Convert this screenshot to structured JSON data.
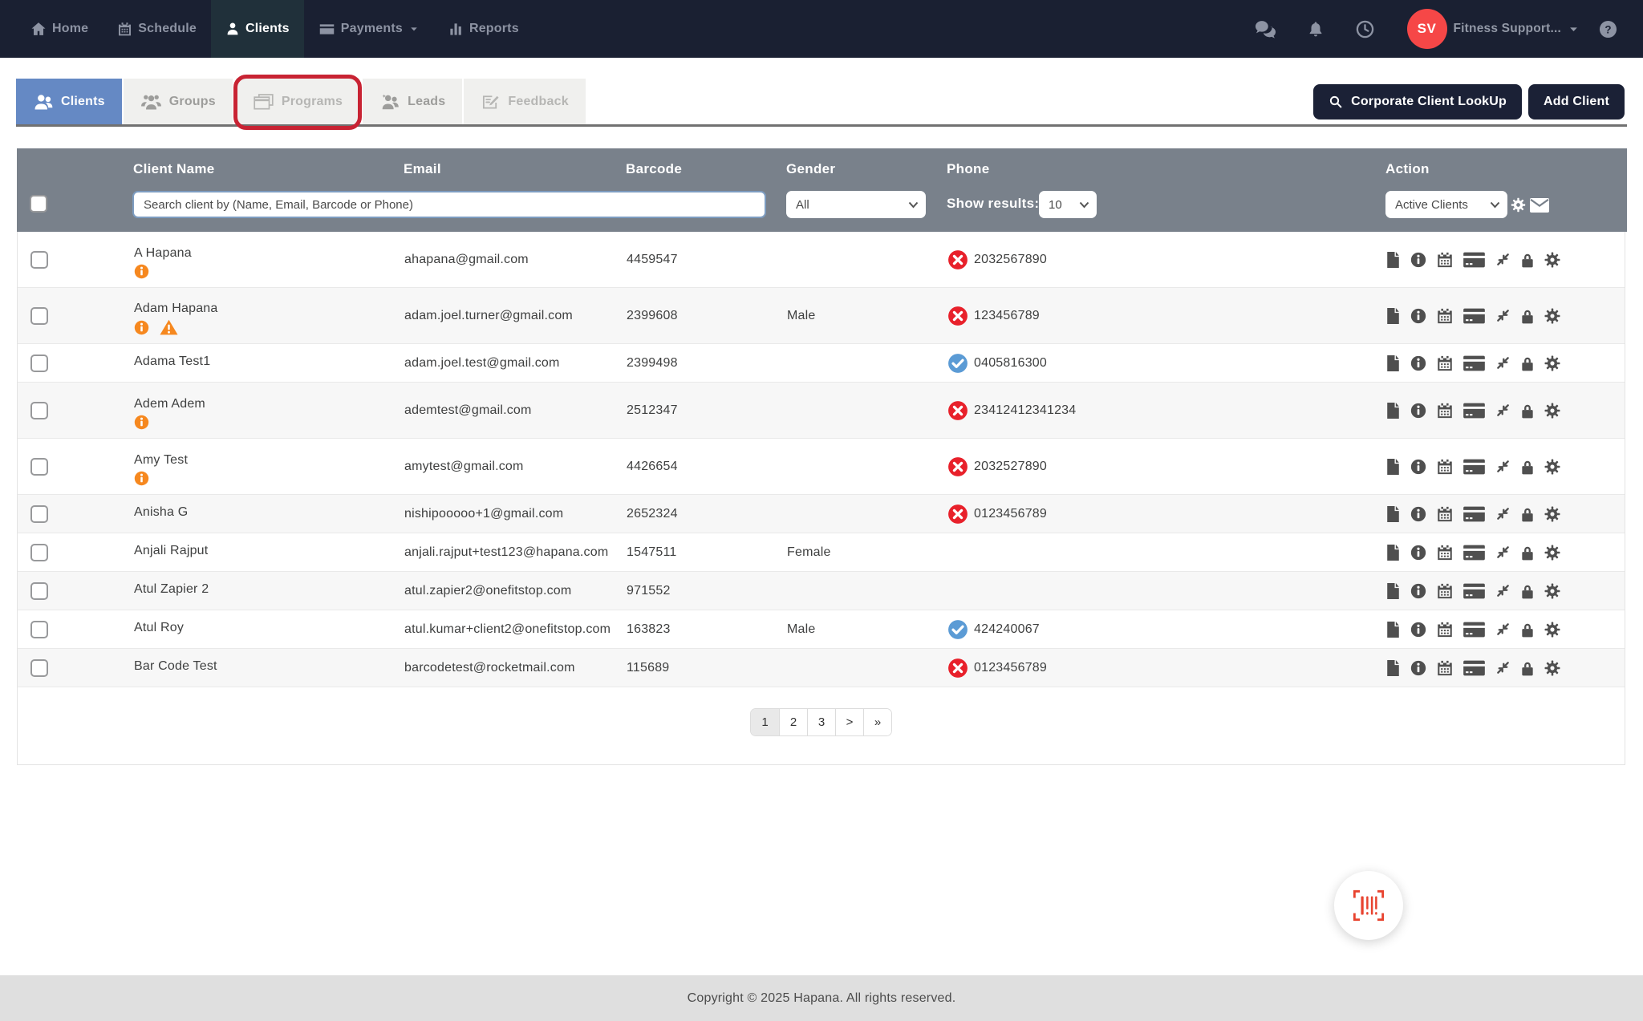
{
  "navbar": {
    "items": [
      {
        "label": "Home"
      },
      {
        "label": "Schedule"
      },
      {
        "label": "Clients",
        "active": true
      },
      {
        "label": "Payments",
        "has_dropdown": true
      },
      {
        "label": "Reports"
      }
    ],
    "avatar_initials": "SV",
    "account_label": "Fitness Support...",
    "right_icons": [
      "chat-icon",
      "bell-icon",
      "clock-icon",
      "help-icon"
    ]
  },
  "tabs": [
    {
      "label": "Clients",
      "active": true
    },
    {
      "label": "Groups"
    },
    {
      "label": "Programs",
      "annotated": true
    },
    {
      "label": "Leads"
    },
    {
      "label": "Feedback"
    }
  ],
  "toolbar": {
    "corporate_lookup_label": "Corporate Client LookUp",
    "add_client_label": "Add Client"
  },
  "table": {
    "columns": [
      "Client Name",
      "Email",
      "Barcode",
      "Gender",
      "Phone",
      "Action"
    ],
    "search_placeholder": "Search client by (Name, Email, Barcode or Phone)",
    "gender_filter_value": "All",
    "show_results_label": "Show results:",
    "show_results_value": "10",
    "action_filter_value": "Active Clients",
    "action_icons": [
      "file-icon",
      "info-icon",
      "calendar-icon",
      "credit-card-icon",
      "compress-icon",
      "lock-icon",
      "gear-icon"
    ],
    "rows": [
      {
        "name": "A Hapana",
        "info": true,
        "warning": false,
        "email": "ahapana@gmail.com",
        "barcode": "4459547",
        "gender": "",
        "phone": "2032567890",
        "phone_invalid": true,
        "phone_valid": false
      },
      {
        "name": "Adam Hapana",
        "info": true,
        "warning": true,
        "email": "adam.joel.turner@gmail.com",
        "barcode": "2399608",
        "gender": "Male",
        "phone": "123456789",
        "phone_invalid": true,
        "phone_valid": false
      },
      {
        "name": "Adama Test1",
        "info": false,
        "warning": false,
        "email": "adam.joel.test@gmail.com",
        "barcode": "2399498",
        "gender": "",
        "phone": "0405816300",
        "phone_invalid": false,
        "phone_valid": true
      },
      {
        "name": "Adem Adem",
        "info": true,
        "warning": false,
        "email": "ademtest@gmail.com",
        "barcode": "2512347",
        "gender": "",
        "phone": "23412412341234",
        "phone_invalid": true,
        "phone_valid": false
      },
      {
        "name": "Amy Test",
        "info": true,
        "warning": false,
        "email": "amytest@gmail.com",
        "barcode": "4426654",
        "gender": "",
        "phone": "2032527890",
        "phone_invalid": true,
        "phone_valid": false
      },
      {
        "name": "Anisha G",
        "info": false,
        "warning": false,
        "email": "nishipooooo+1@gmail.com",
        "barcode": "2652324",
        "gender": "",
        "phone": "0123456789",
        "phone_invalid": true,
        "phone_valid": false
      },
      {
        "name": "Anjali Rajput",
        "info": false,
        "warning": false,
        "email": "anjali.rajput+test123@hapana.com",
        "barcode": "1547511",
        "gender": "Female",
        "phone": "",
        "phone_invalid": false,
        "phone_valid": false
      },
      {
        "name": "Atul Zapier 2",
        "info": false,
        "warning": false,
        "email": "atul.zapier2@onefitstop.com",
        "barcode": "971552",
        "gender": "",
        "phone": "",
        "phone_invalid": false,
        "phone_valid": false
      },
      {
        "name": "Atul Roy",
        "info": false,
        "warning": false,
        "email": "atul.kumar+client2@onefitstop.com",
        "barcode": "163823",
        "gender": "Male",
        "phone": "424240067",
        "phone_invalid": false,
        "phone_valid": true
      },
      {
        "name": "Bar Code Test",
        "info": false,
        "warning": false,
        "email": "barcodetest@rocketmail.com",
        "barcode": "115689",
        "gender": "",
        "phone": "0123456789",
        "phone_invalid": true,
        "phone_valid": false
      }
    ]
  },
  "pagination": {
    "items": [
      {
        "label": "1",
        "active": true
      },
      {
        "label": "2"
      },
      {
        "label": "3"
      },
      {
        "label": ">"
      },
      {
        "label": "»"
      }
    ]
  },
  "footer": {
    "copyright": "Copyright © 2025 Hapana. All rights reserved."
  },
  "colors": {
    "navbar_bg": "#1a2032",
    "navbar_active_bg": "#20303a",
    "tab_active_bg": "#6589c4",
    "table_header_bg": "#79818b",
    "accent_orange": "#f6881f",
    "phone_invalid_red": "#e8212b",
    "phone_valid_blue": "#5b9bd5",
    "avatar_red": "#f64747",
    "annotation_red": "#c82333",
    "button_dark": "#1b2136",
    "scan_icon_red": "#e8432f"
  }
}
